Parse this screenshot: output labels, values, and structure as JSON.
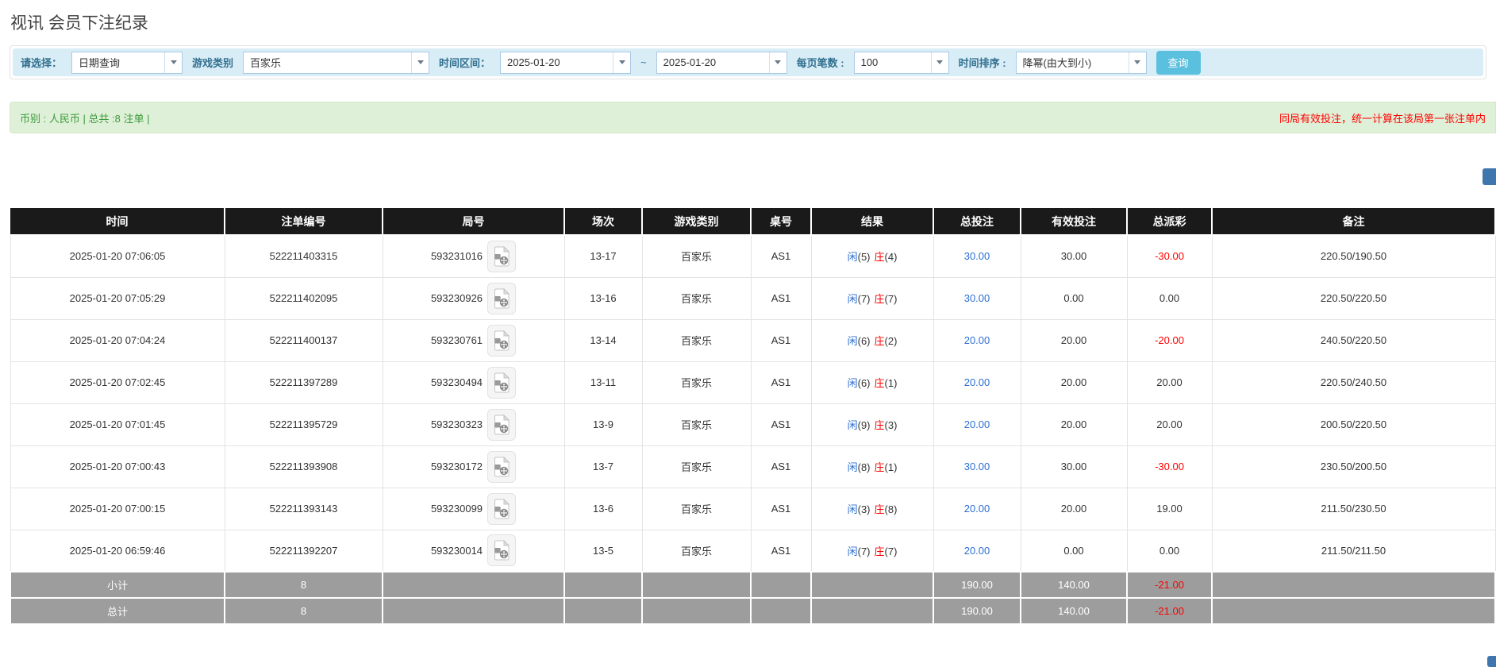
{
  "page": {
    "title": "视讯 会员下注纪录"
  },
  "filters": {
    "select_label": "请选择：",
    "select_value": "日期查询",
    "game_type_label": "游戏类别",
    "game_type_value": "百家乐",
    "date_range_label": "时间区间：",
    "date_from": "2025-01-20",
    "range_separator": "~",
    "date_to": "2025-01-20",
    "page_size_label": "每页笔数 :",
    "page_size_value": "100",
    "sort_label": "时间排序 :",
    "sort_value": "降幂(由大到小)",
    "search_button": "查询"
  },
  "summary": {
    "left_text": "币别 : 人民币 | 总共 :8 注单 |",
    "right_notice": "同局有效投注，统一计算在该局第一张注单内"
  },
  "table": {
    "columns": [
      "时间",
      "注单编号",
      "局号",
      "场次",
      "游戏类别",
      "桌号",
      "结果",
      "总投注",
      "有效投注",
      "总派彩",
      "备注"
    ],
    "rows": [
      {
        "time": "2025-01-20 07:06:05",
        "bet_id": "522211403315",
        "round": "593231016",
        "session": "13-17",
        "game": "百家乐",
        "table_no": "AS1",
        "result": {
          "player": "闲",
          "player_score": "(5)",
          "banker": "庄",
          "banker_score": "(4)"
        },
        "total_bet": "30.00",
        "valid_bet": "30.00",
        "payout": "-30.00",
        "note": "220.50/190.50"
      },
      {
        "time": "2025-01-20 07:05:29",
        "bet_id": "522211402095",
        "round": "593230926",
        "session": "13-16",
        "game": "百家乐",
        "table_no": "AS1",
        "result": {
          "player": "闲",
          "player_score": "(7)",
          "banker": "庄",
          "banker_score": "(7)"
        },
        "total_bet": "30.00",
        "valid_bet": "0.00",
        "payout": "0.00",
        "note": "220.50/220.50"
      },
      {
        "time": "2025-01-20 07:04:24",
        "bet_id": "522211400137",
        "round": "593230761",
        "session": "13-14",
        "game": "百家乐",
        "table_no": "AS1",
        "result": {
          "player": "闲",
          "player_score": "(6)",
          "banker": "庄",
          "banker_score": "(2)"
        },
        "total_bet": "20.00",
        "valid_bet": "20.00",
        "payout": "-20.00",
        "note": "240.50/220.50"
      },
      {
        "time": "2025-01-20 07:02:45",
        "bet_id": "522211397289",
        "round": "593230494",
        "session": "13-11",
        "game": "百家乐",
        "table_no": "AS1",
        "result": {
          "player": "闲",
          "player_score": "(6)",
          "banker": "庄",
          "banker_score": "(1)"
        },
        "total_bet": "20.00",
        "valid_bet": "20.00",
        "payout": "20.00",
        "note": "220.50/240.50"
      },
      {
        "time": "2025-01-20 07:01:45",
        "bet_id": "522211395729",
        "round": "593230323",
        "session": "13-9",
        "game": "百家乐",
        "table_no": "AS1",
        "result": {
          "player": "闲",
          "player_score": "(9)",
          "banker": "庄",
          "banker_score": "(3)"
        },
        "total_bet": "20.00",
        "valid_bet": "20.00",
        "payout": "20.00",
        "note": "200.50/220.50"
      },
      {
        "time": "2025-01-20 07:00:43",
        "bet_id": "522211393908",
        "round": "593230172",
        "session": "13-7",
        "game": "百家乐",
        "table_no": "AS1",
        "result": {
          "player": "闲",
          "player_score": "(8)",
          "banker": "庄",
          "banker_score": "(1)"
        },
        "total_bet": "30.00",
        "valid_bet": "30.00",
        "payout": "-30.00",
        "note": "230.50/200.50"
      },
      {
        "time": "2025-01-20 07:00:15",
        "bet_id": "522211393143",
        "round": "593230099",
        "session": "13-6",
        "game": "百家乐",
        "table_no": "AS1",
        "result": {
          "player": "闲",
          "player_score": "(3)",
          "banker": "庄",
          "banker_score": "(8)"
        },
        "total_bet": "20.00",
        "valid_bet": "20.00",
        "payout": "19.00",
        "note": "211.50/230.50"
      },
      {
        "time": "2025-01-20 06:59:46",
        "bet_id": "522211392207",
        "round": "593230014",
        "session": "13-5",
        "game": "百家乐",
        "table_no": "AS1",
        "result": {
          "player": "闲",
          "player_score": "(7)",
          "banker": "庄",
          "banker_score": "(7)"
        },
        "total_bet": "20.00",
        "valid_bet": "0.00",
        "payout": "0.00",
        "note": "211.50/211.50"
      }
    ],
    "subtotal_row": {
      "label": "小计",
      "count": "8",
      "total_bet": "190.00",
      "valid_bet": "140.00",
      "payout": "-21.00"
    },
    "total_row": {
      "label": "总计",
      "count": "8",
      "total_bet": "190.00",
      "valid_bet": "140.00",
      "payout": "-21.00"
    }
  },
  "icons": {
    "combo_arrow": "chevron-down-icon",
    "round_video": "video-replay-file-icon"
  },
  "colors": {
    "accent": "#5bc0de",
    "info_bg": "#d9edf7",
    "success_bg": "#dff0d8",
    "header_bg": "#1a1a1a",
    "footer_bg": "#9d9d9d",
    "link_blue": "#2d6fd2",
    "negative_red": "#ff0000"
  }
}
